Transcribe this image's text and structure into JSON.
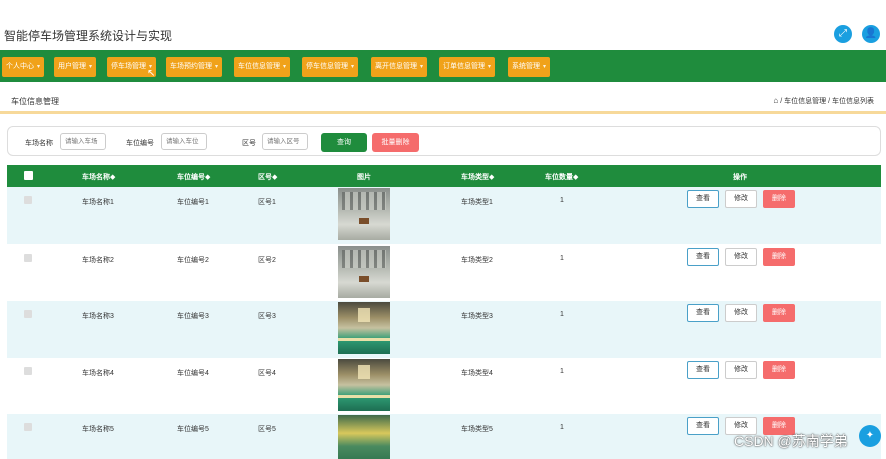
{
  "header": {
    "title": "智能停车场管理系统设计与实现",
    "fullscreen_icon": "fullscreen-icon",
    "user_icon": "user-icon"
  },
  "nav": {
    "items": [
      {
        "label": "个人中心"
      },
      {
        "label": "用户管理"
      },
      {
        "label": "停车场管理"
      },
      {
        "label": "车场预约管理"
      },
      {
        "label": "车位信息管理"
      },
      {
        "label": "停车信息管理"
      },
      {
        "label": "离开信息管理"
      },
      {
        "label": "订单信息管理"
      },
      {
        "label": "系统管理"
      }
    ]
  },
  "page": {
    "heading": "车位信息管理",
    "breadcrumb": "/ 车位信息管理 / 车位信息列表"
  },
  "search": {
    "lot_name_label": "车场名称",
    "lot_name_placeholder": "请输入车场",
    "spot_no_label": "车位编号",
    "spot_no_placeholder": "请输入车位",
    "zone_label": "区号",
    "zone_placeholder": "请输入区号",
    "search_button": "查询",
    "batch_delete_button": "批量删除"
  },
  "table": {
    "headers": {
      "lot_name": "车场名称◆",
      "spot_no": "车位编号◆",
      "zone": "区号◆",
      "image": "图片",
      "lot_type": "车场类型◆",
      "spot_count": "车位数量◆",
      "actions": "操作"
    },
    "rows": [
      {
        "lot_name": "车场名称1",
        "spot_no": "车位编号1",
        "zone": "区号1",
        "lot_type": "车场类型1",
        "spot_count": "1",
        "image": "gray"
      },
      {
        "lot_name": "车场名称2",
        "spot_no": "车位编号2",
        "zone": "区号2",
        "lot_type": "车场类型2",
        "spot_count": "1",
        "image": "gray"
      },
      {
        "lot_name": "车场名称3",
        "spot_no": "车位编号3",
        "zone": "区号3",
        "lot_type": "车场类型3",
        "spot_count": "1",
        "image": "green"
      },
      {
        "lot_name": "车场名称4",
        "spot_no": "车位编号4",
        "zone": "区号4",
        "lot_type": "车场类型4",
        "spot_count": "1",
        "image": "green"
      },
      {
        "lot_name": "车场名称5",
        "spot_no": "车位编号5",
        "zone": "区号5",
        "lot_type": "车场类型5",
        "spot_count": "1",
        "image": "yellow"
      }
    ],
    "action_labels": {
      "view": "查看",
      "edit": "修改",
      "delete": "删除"
    }
  },
  "watermark": "CSDN @苏南学弟",
  "colors": {
    "nav_bg": "#1f8c3d",
    "nav_item": "#f0a21a",
    "delete": "#f56c6c",
    "row_alt": "#e8f6f9"
  }
}
